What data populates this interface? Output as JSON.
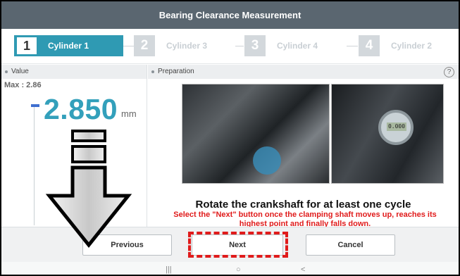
{
  "window": {
    "title": "Bearing Clearance Measurement"
  },
  "steps": [
    {
      "num": "1",
      "label": "Cylinder 1",
      "state": "active"
    },
    {
      "num": "2",
      "label": "Cylinder 3",
      "state": "inactive"
    },
    {
      "num": "3",
      "label": "Cylinder 4",
      "state": "inactive"
    },
    {
      "num": "4",
      "label": "Cylinder 2",
      "state": "inactive"
    }
  ],
  "value_panel": {
    "header": "Value",
    "max_label": "Max : 2.86",
    "value": "2.850",
    "unit": "mm"
  },
  "prep_panel": {
    "header": "Preparation",
    "help_glyph": "?",
    "gauge_readout": "0.000",
    "instruction_title": "Rotate the crankshaft for at least one cycle",
    "instruction_detail": "Select the \"Next\" button once the clamping shaft moves up, reaches its highest point and finally falls down."
  },
  "buttons": {
    "previous": "Previous",
    "next": "Next",
    "cancel": "Cancel"
  },
  "navbar": {
    "recents": "|||",
    "home": "○",
    "back": "<"
  },
  "colors": {
    "title_bg": "#5a6670",
    "accent": "#2f9ab3",
    "value_text": "#33a0bb",
    "warning": "#e01b1b"
  }
}
